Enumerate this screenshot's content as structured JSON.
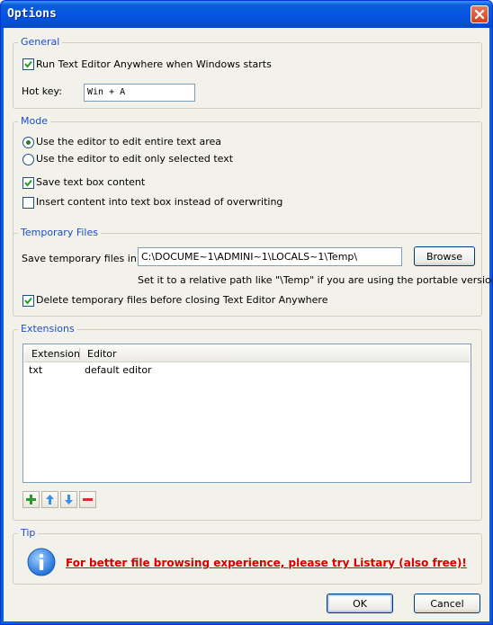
{
  "window": {
    "title": "Options"
  },
  "general": {
    "legend": "General",
    "run_at_startup": {
      "label": "Run Text Editor Anywhere when Windows starts",
      "checked": true
    },
    "hotkey_label": "Hot key:",
    "hotkey_value": "Win + A"
  },
  "mode": {
    "legend": "Mode",
    "radio_entire": {
      "label": "Use the editor to edit entire text area",
      "selected": true
    },
    "radio_selected": {
      "label": "Use the editor to edit only selected text",
      "selected": false
    },
    "save_textbox": {
      "label": "Save text box content",
      "checked": true
    },
    "insert_content": {
      "label": "Insert content into text box instead of overwriting",
      "checked": false
    }
  },
  "temp": {
    "legend": "Temporary Files",
    "save_label": "Save temporary files in:",
    "path_value": "C:\\DOCUME~1\\ADMINI~1\\LOCALS~1\\Temp\\",
    "browse_label": "Browse",
    "hint": "Set it to a relative path like \"\\Temp\" if you are using the portable version.",
    "delete_before_close": {
      "label": "Delete temporary files before closing Text Editor Anywhere",
      "checked": true
    }
  },
  "extensions": {
    "legend": "Extensions",
    "columns": [
      "Extension",
      "Editor"
    ],
    "rows": [
      {
        "extension": "txt",
        "editor": "default editor"
      }
    ],
    "toolbar_icons": [
      "add-icon",
      "move-up-icon",
      "move-down-icon",
      "remove-icon"
    ]
  },
  "tip": {
    "legend": "Tip",
    "link_text": "For better file browsing experience, please try Listary (also free)!"
  },
  "footer": {
    "ok_label": "OK",
    "cancel_label": "Cancel"
  },
  "colors": {
    "titlebar": "#0554e3",
    "legend": "#1c4fc5",
    "link": "#d40000",
    "background": "#f3f2ea"
  }
}
